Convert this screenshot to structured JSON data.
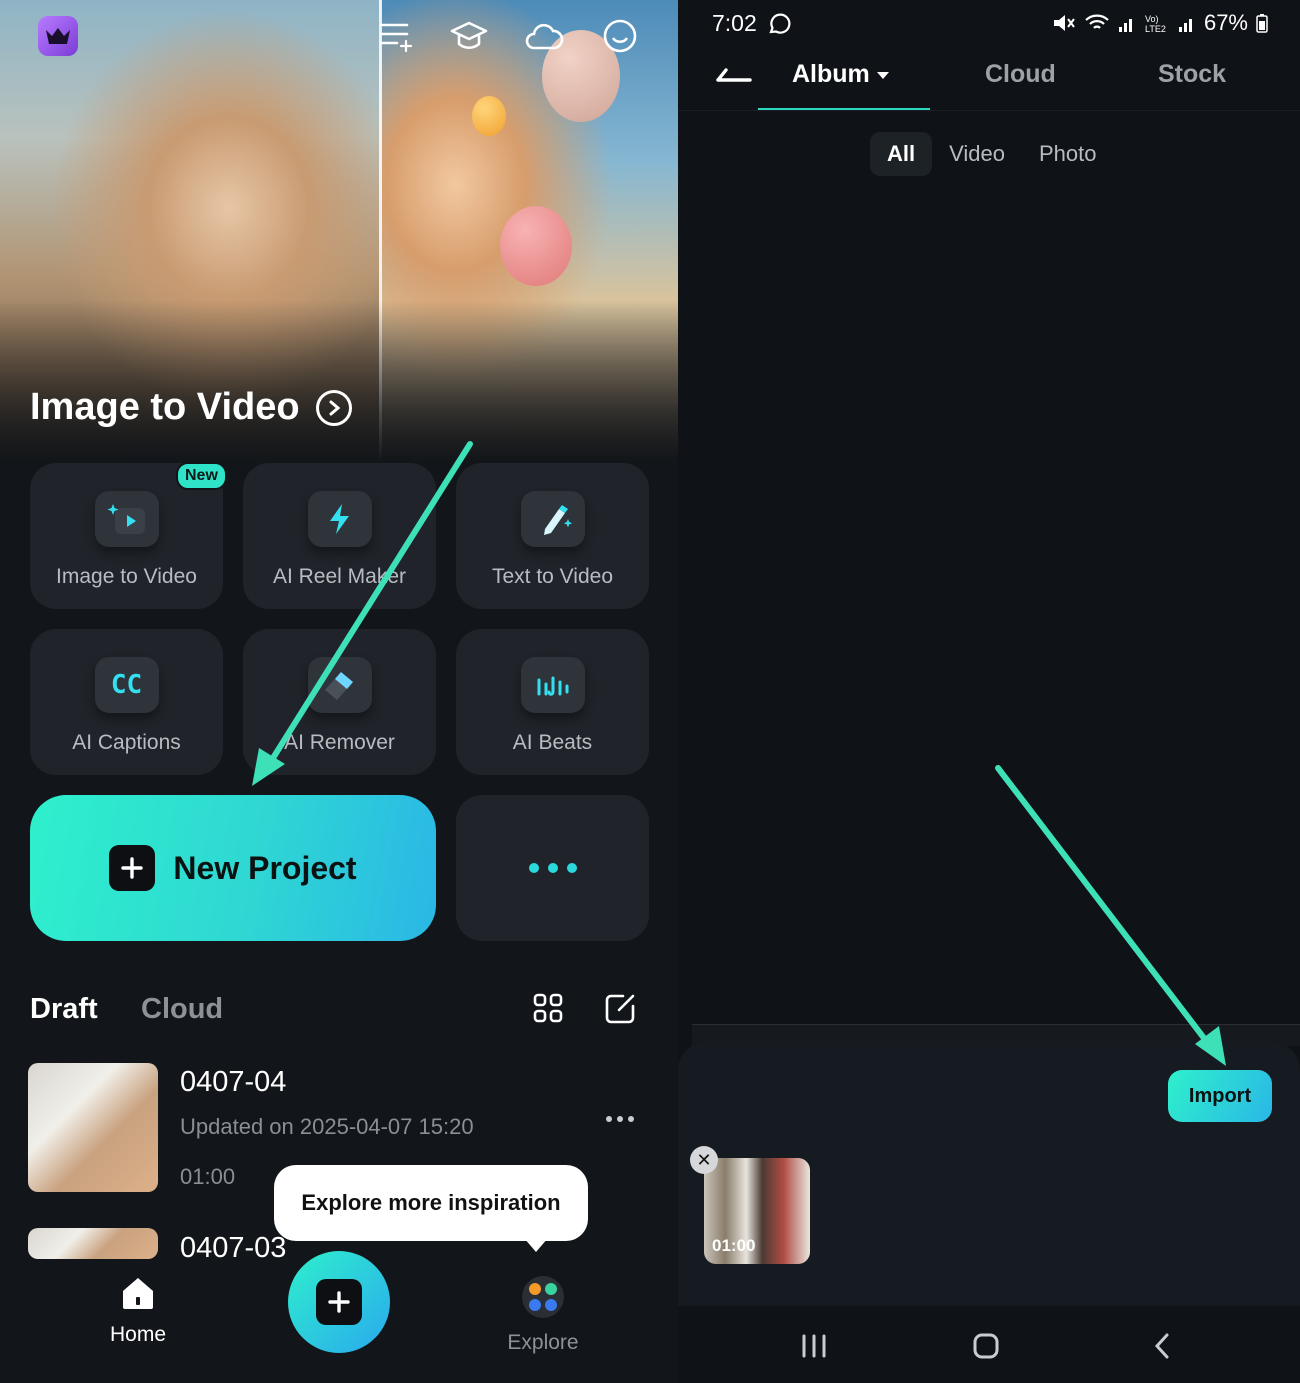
{
  "left": {
    "hero": {
      "title": "Image to Video"
    },
    "top_icons": [
      "crown-icon",
      "menu-sparkle-icon",
      "graduation-cap-icon",
      "cloud-icon",
      "smiley-icon"
    ],
    "tools": [
      {
        "label": "Image to Video",
        "icon": "image-to-video-icon",
        "badge": "New"
      },
      {
        "label": "AI Reel Maker",
        "icon": "lightning-icon"
      },
      {
        "label": "Text to Video",
        "icon": "pencil-sparkle-icon"
      },
      {
        "label": "AI Captions",
        "icon": "cc-icon"
      },
      {
        "label": "AI Remover",
        "icon": "eraser-icon"
      },
      {
        "label": "AI Beats",
        "icon": "music-sparkle-icon"
      }
    ],
    "new_project_label": "New Project",
    "tabs": {
      "draft": "Draft",
      "cloud": "Cloud"
    },
    "drafts": [
      {
        "title": "0407-04",
        "updated": "Updated on 2025-04-07 15:20",
        "duration": "01:00"
      },
      {
        "title": "0407-03"
      }
    ],
    "tooltip": "Explore more inspiration",
    "nav": {
      "home": "Home",
      "explore": "Explore"
    }
  },
  "right": {
    "status": {
      "time": "7:02",
      "battery": "67%"
    },
    "tabs": {
      "album": "Album",
      "cloud": "Cloud",
      "stock": "Stock"
    },
    "filters": [
      "All",
      "Video",
      "Photo"
    ],
    "import_label": "Import",
    "selected": {
      "duration": "01:00"
    }
  },
  "colors": {
    "accent": "#2ef0cc",
    "accent2": "#2ab7e6",
    "bg": "#121519",
    "tile": "#20242a",
    "arrow": "#3ee0b8"
  }
}
